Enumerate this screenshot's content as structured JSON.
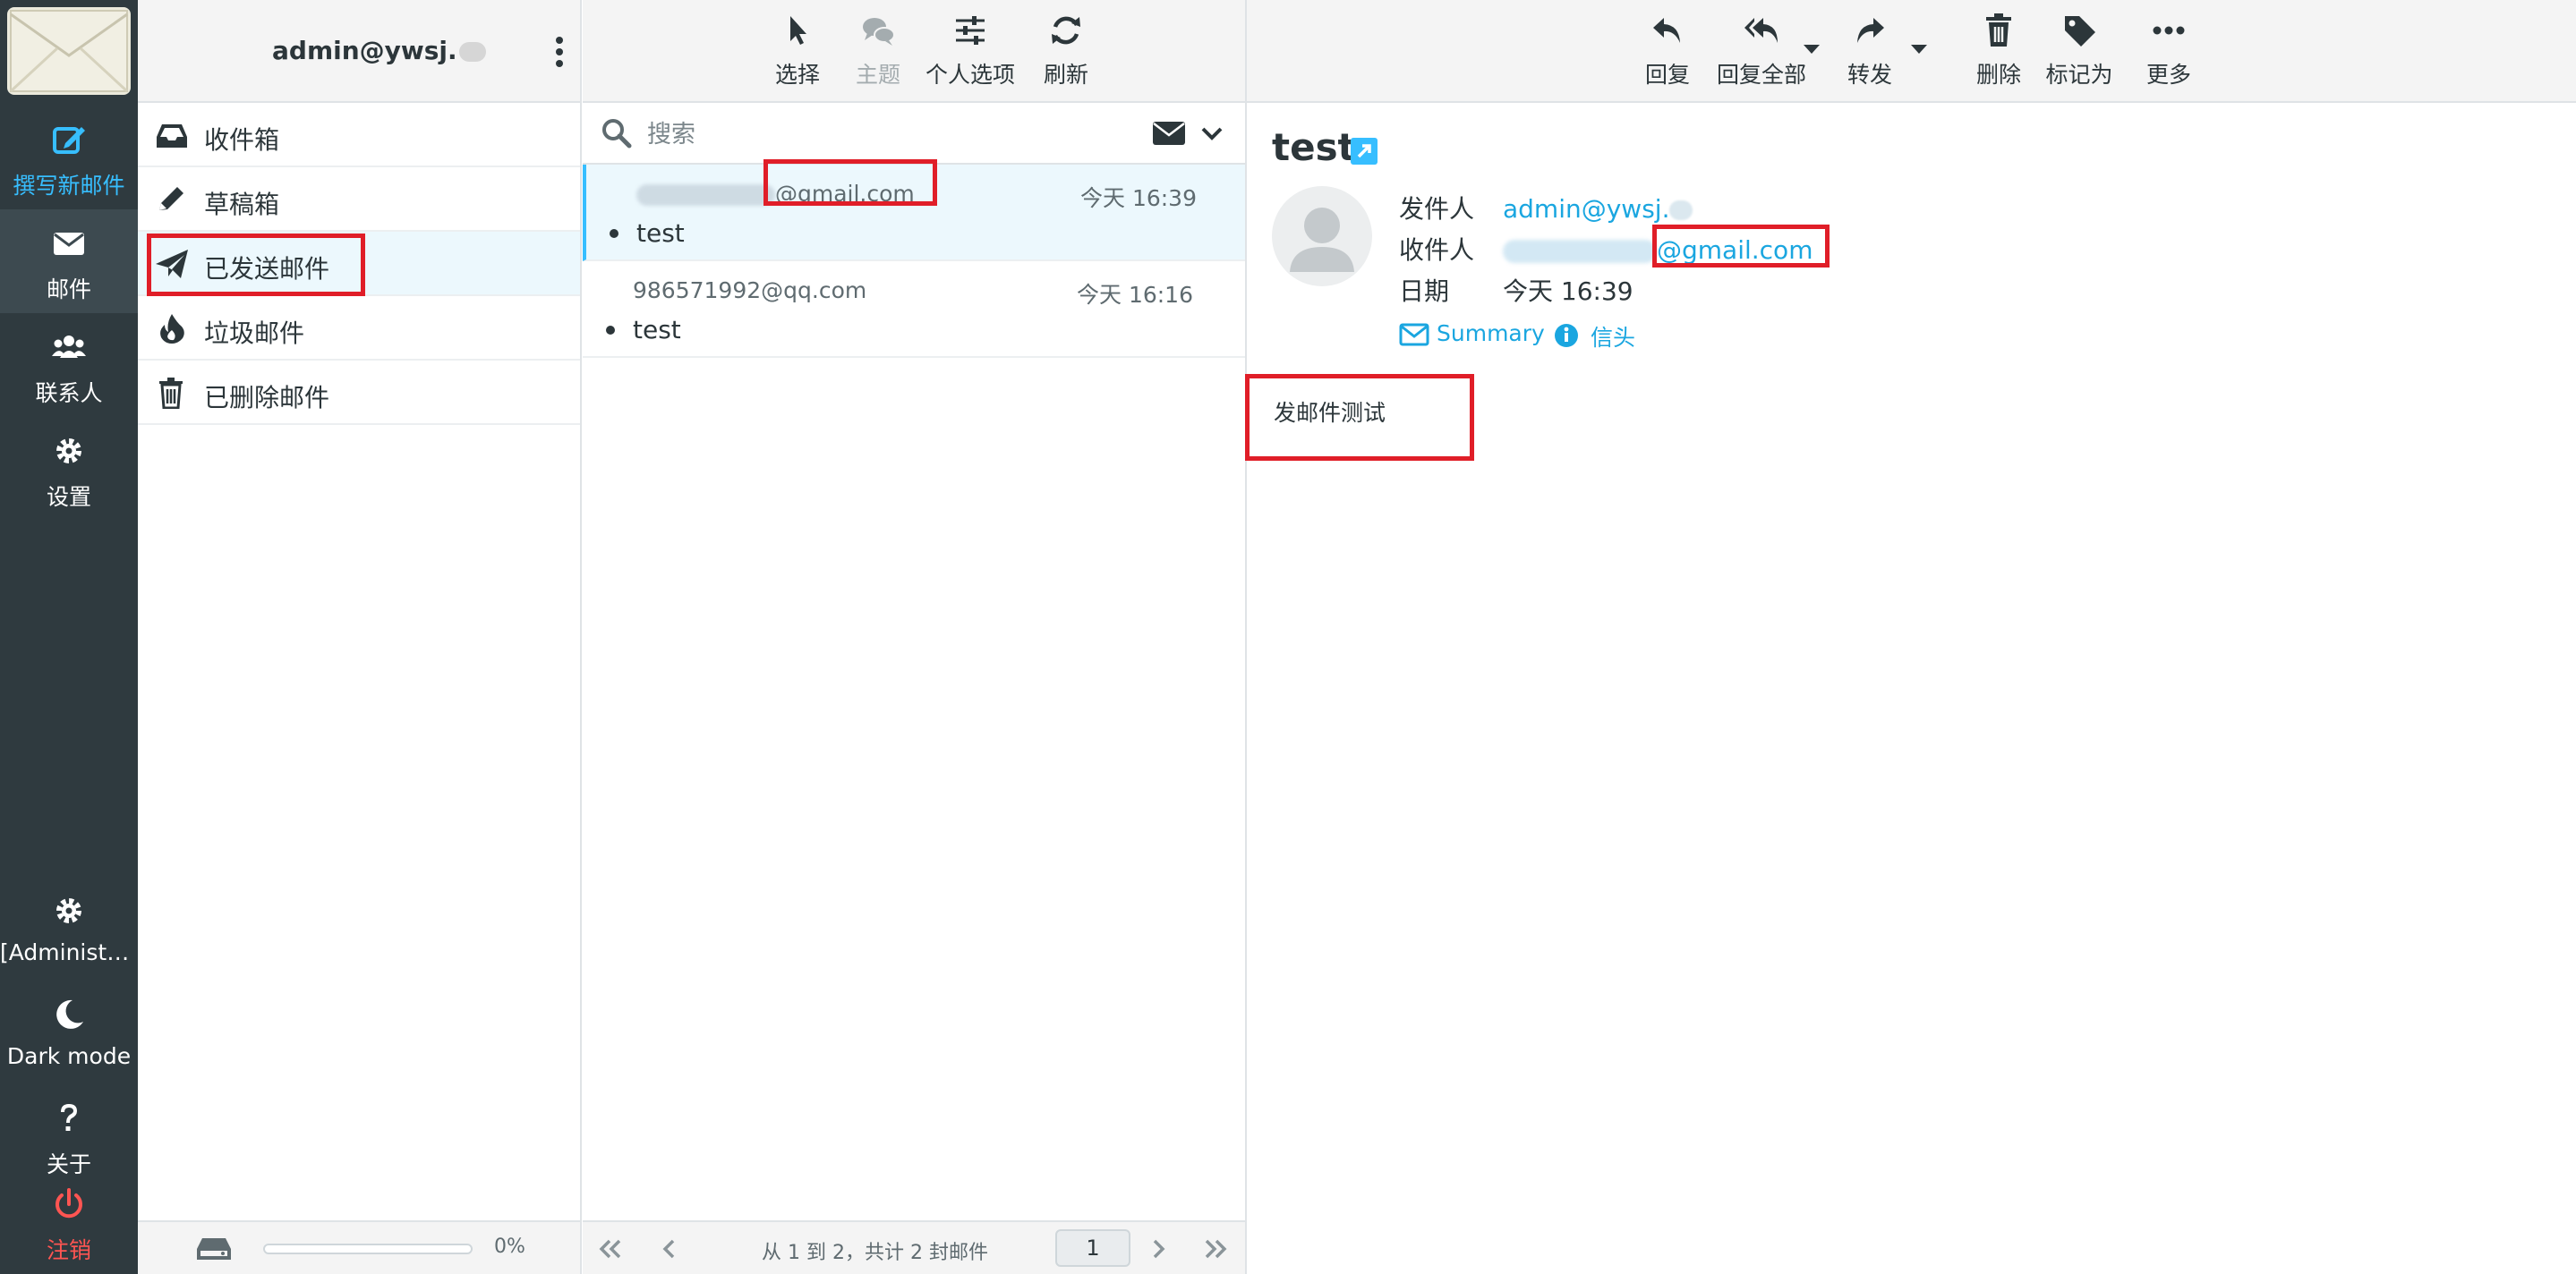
{
  "rail": {
    "compose": "撰写新邮件",
    "mail": "邮件",
    "contacts": "联系人",
    "settings": "设置",
    "admin": "[Administrator]",
    "dark_mode": "Dark mode",
    "about": "关于",
    "logout": "注销"
  },
  "account": {
    "user": "admin@ywsj."
  },
  "folders": [
    {
      "label": "收件箱",
      "icon": "inbox-icon"
    },
    {
      "label": "草稿箱",
      "icon": "pencil-icon"
    },
    {
      "label": "已发送邮件",
      "icon": "paper-plane-icon"
    },
    {
      "label": "垃圾邮件",
      "icon": "fire-icon"
    },
    {
      "label": "已删除邮件",
      "icon": "trash-icon"
    }
  ],
  "quota": {
    "percent_label": "0%",
    "percent": 0
  },
  "list_toolbar": {
    "select": "选择",
    "threads": "主题",
    "options": "个人选项",
    "refresh": "刷新"
  },
  "search": {
    "placeholder": "搜索"
  },
  "messages": [
    {
      "from": "@gmail.com",
      "date": "今天 16:39",
      "subject": "test"
    },
    {
      "from": "986571992@qq.com",
      "date": "今天 16:16",
      "subject": "test"
    }
  ],
  "pager": {
    "count": "从 1 到 2，共计 2 封邮件",
    "page": "1"
  },
  "reader_toolbar": {
    "reply": "回复",
    "reply_all": "回复全部",
    "forward": "转发",
    "delete": "删除",
    "mark": "标记为",
    "more": "更多"
  },
  "message": {
    "subject": "test",
    "from_label": "发件人",
    "from_value": "admin@ywsj.",
    "to_label": "收件人",
    "to_value": "@gmail.com",
    "date_label": "日期",
    "date_value": "今天 16:39",
    "summary": "Summary",
    "headers": "信头",
    "body": "发邮件测试"
  },
  "colors": {
    "rail_bg": "#2f3a3f",
    "accent": "#37beff",
    "link": "#1aa6e0",
    "logout": "#ff5552",
    "annotation": "#e01e28"
  }
}
